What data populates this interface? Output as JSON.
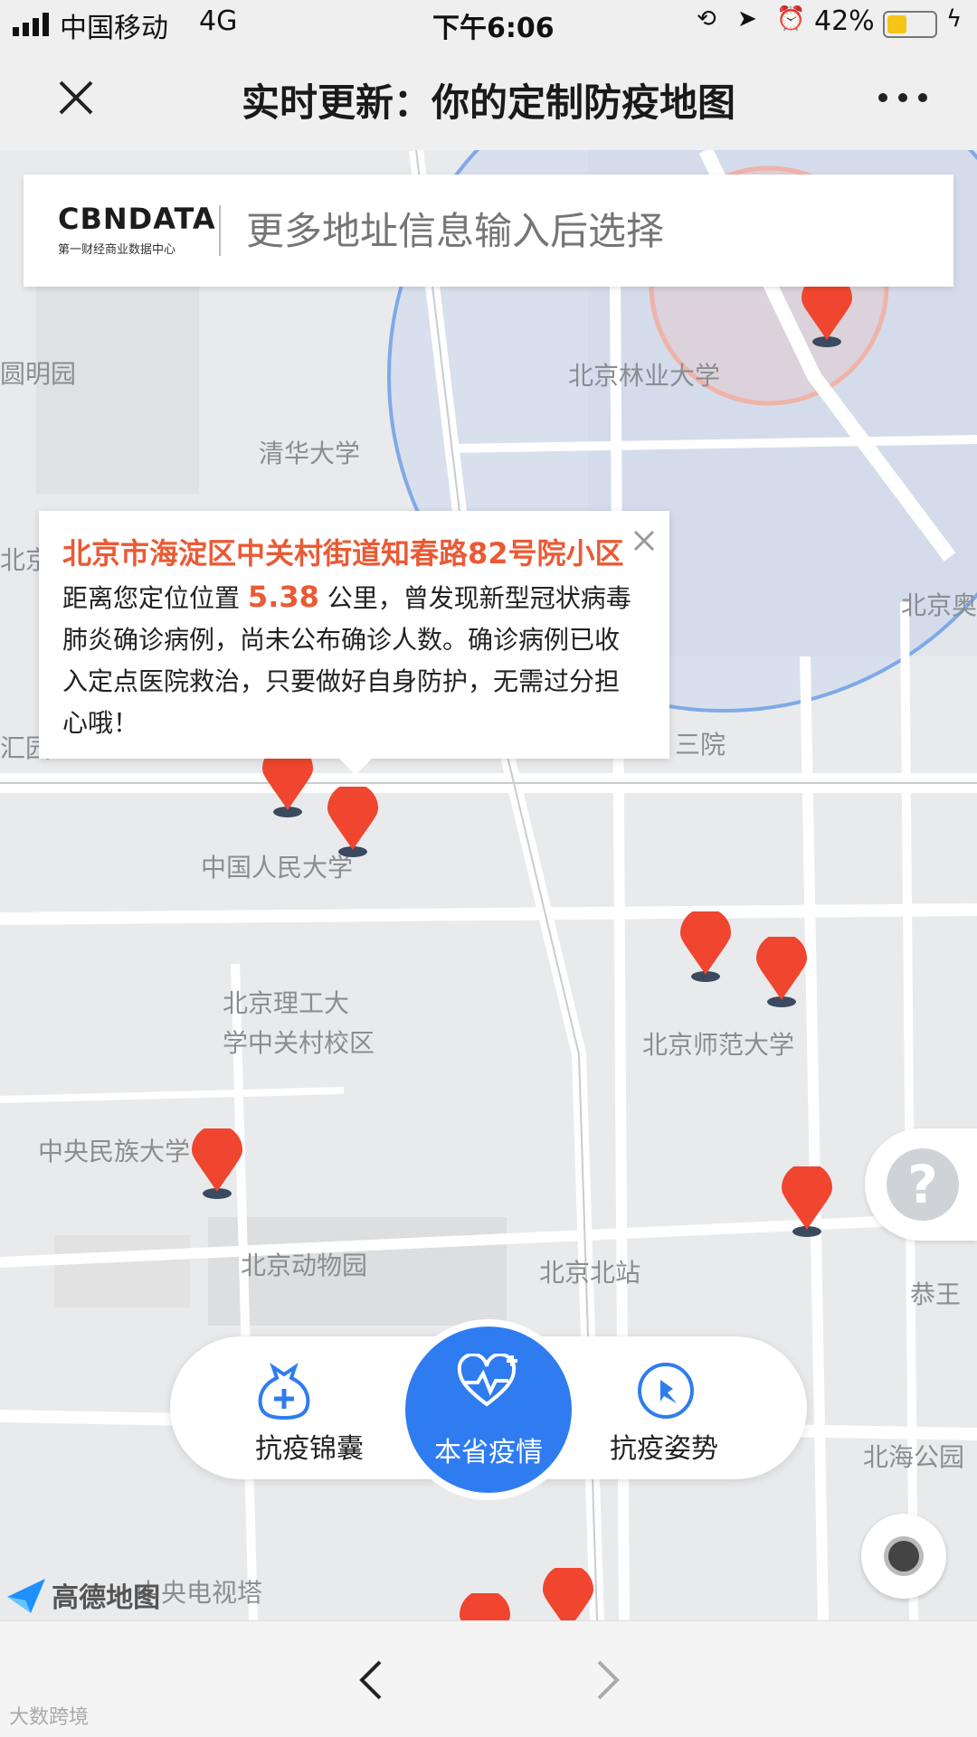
{
  "status_bar": {
    "carrier": "中国移动",
    "network": "4G",
    "time": "下午6:06",
    "battery_percent": "42%",
    "battery_level": 0.42
  },
  "nav": {
    "title": "实时更新：你的定制防疫地图",
    "close_icon": "close-icon",
    "more_icon": "more-icon"
  },
  "search": {
    "logo_text": "CBNDATA",
    "logo_subtitle": "第一财经商业数据中心",
    "placeholder": "更多地址信息输入后选择"
  },
  "popup": {
    "address": "北京市海淀区中关村街道知春路82号院小区",
    "distance_prefix": "距离您定位位置",
    "distance": "5.38",
    "message": "公里，曾发现新型冠状病毒肺炎确诊病例，尚未公布确诊人数。确诊病例已收入定点医院救治，只要做好自身防护，无需过分担心哦！"
  },
  "map_labels": {
    "yuanmingyuan": "圆明园",
    "linye": "北京林业大学",
    "qinghua": "清华大学",
    "bei_left": "北京",
    "bei_right": "北京奥",
    "huiyuan": "汇园",
    "sanyuan": "三院",
    "renmin": "中国人民大学",
    "ligong_1": "北京理工大",
    "ligong_2": "学中关村校区",
    "shifan": "北京师范大学",
    "minzu": "中央民族大学",
    "dongwuyuan": "北京动物园",
    "beizhan": "北京北站",
    "gongwang": "恭王",
    "beihai": "北海公园",
    "dianshita": "中央电视塔",
    "amap_logo": "高德地图"
  },
  "bottom_nav": {
    "items": [
      {
        "label": "抗疫锦囊",
        "icon": "pouch-cross-icon"
      },
      {
        "label": "本省疫情",
        "icon": "heart-pulse-icon"
      },
      {
        "label": "抗疫姿势",
        "icon": "pin-icon"
      }
    ]
  },
  "colors": {
    "accent": "#2f7cf0",
    "highlight": "#ea5a35",
    "marker": "#f0452f"
  },
  "watermark": "大数跨境"
}
